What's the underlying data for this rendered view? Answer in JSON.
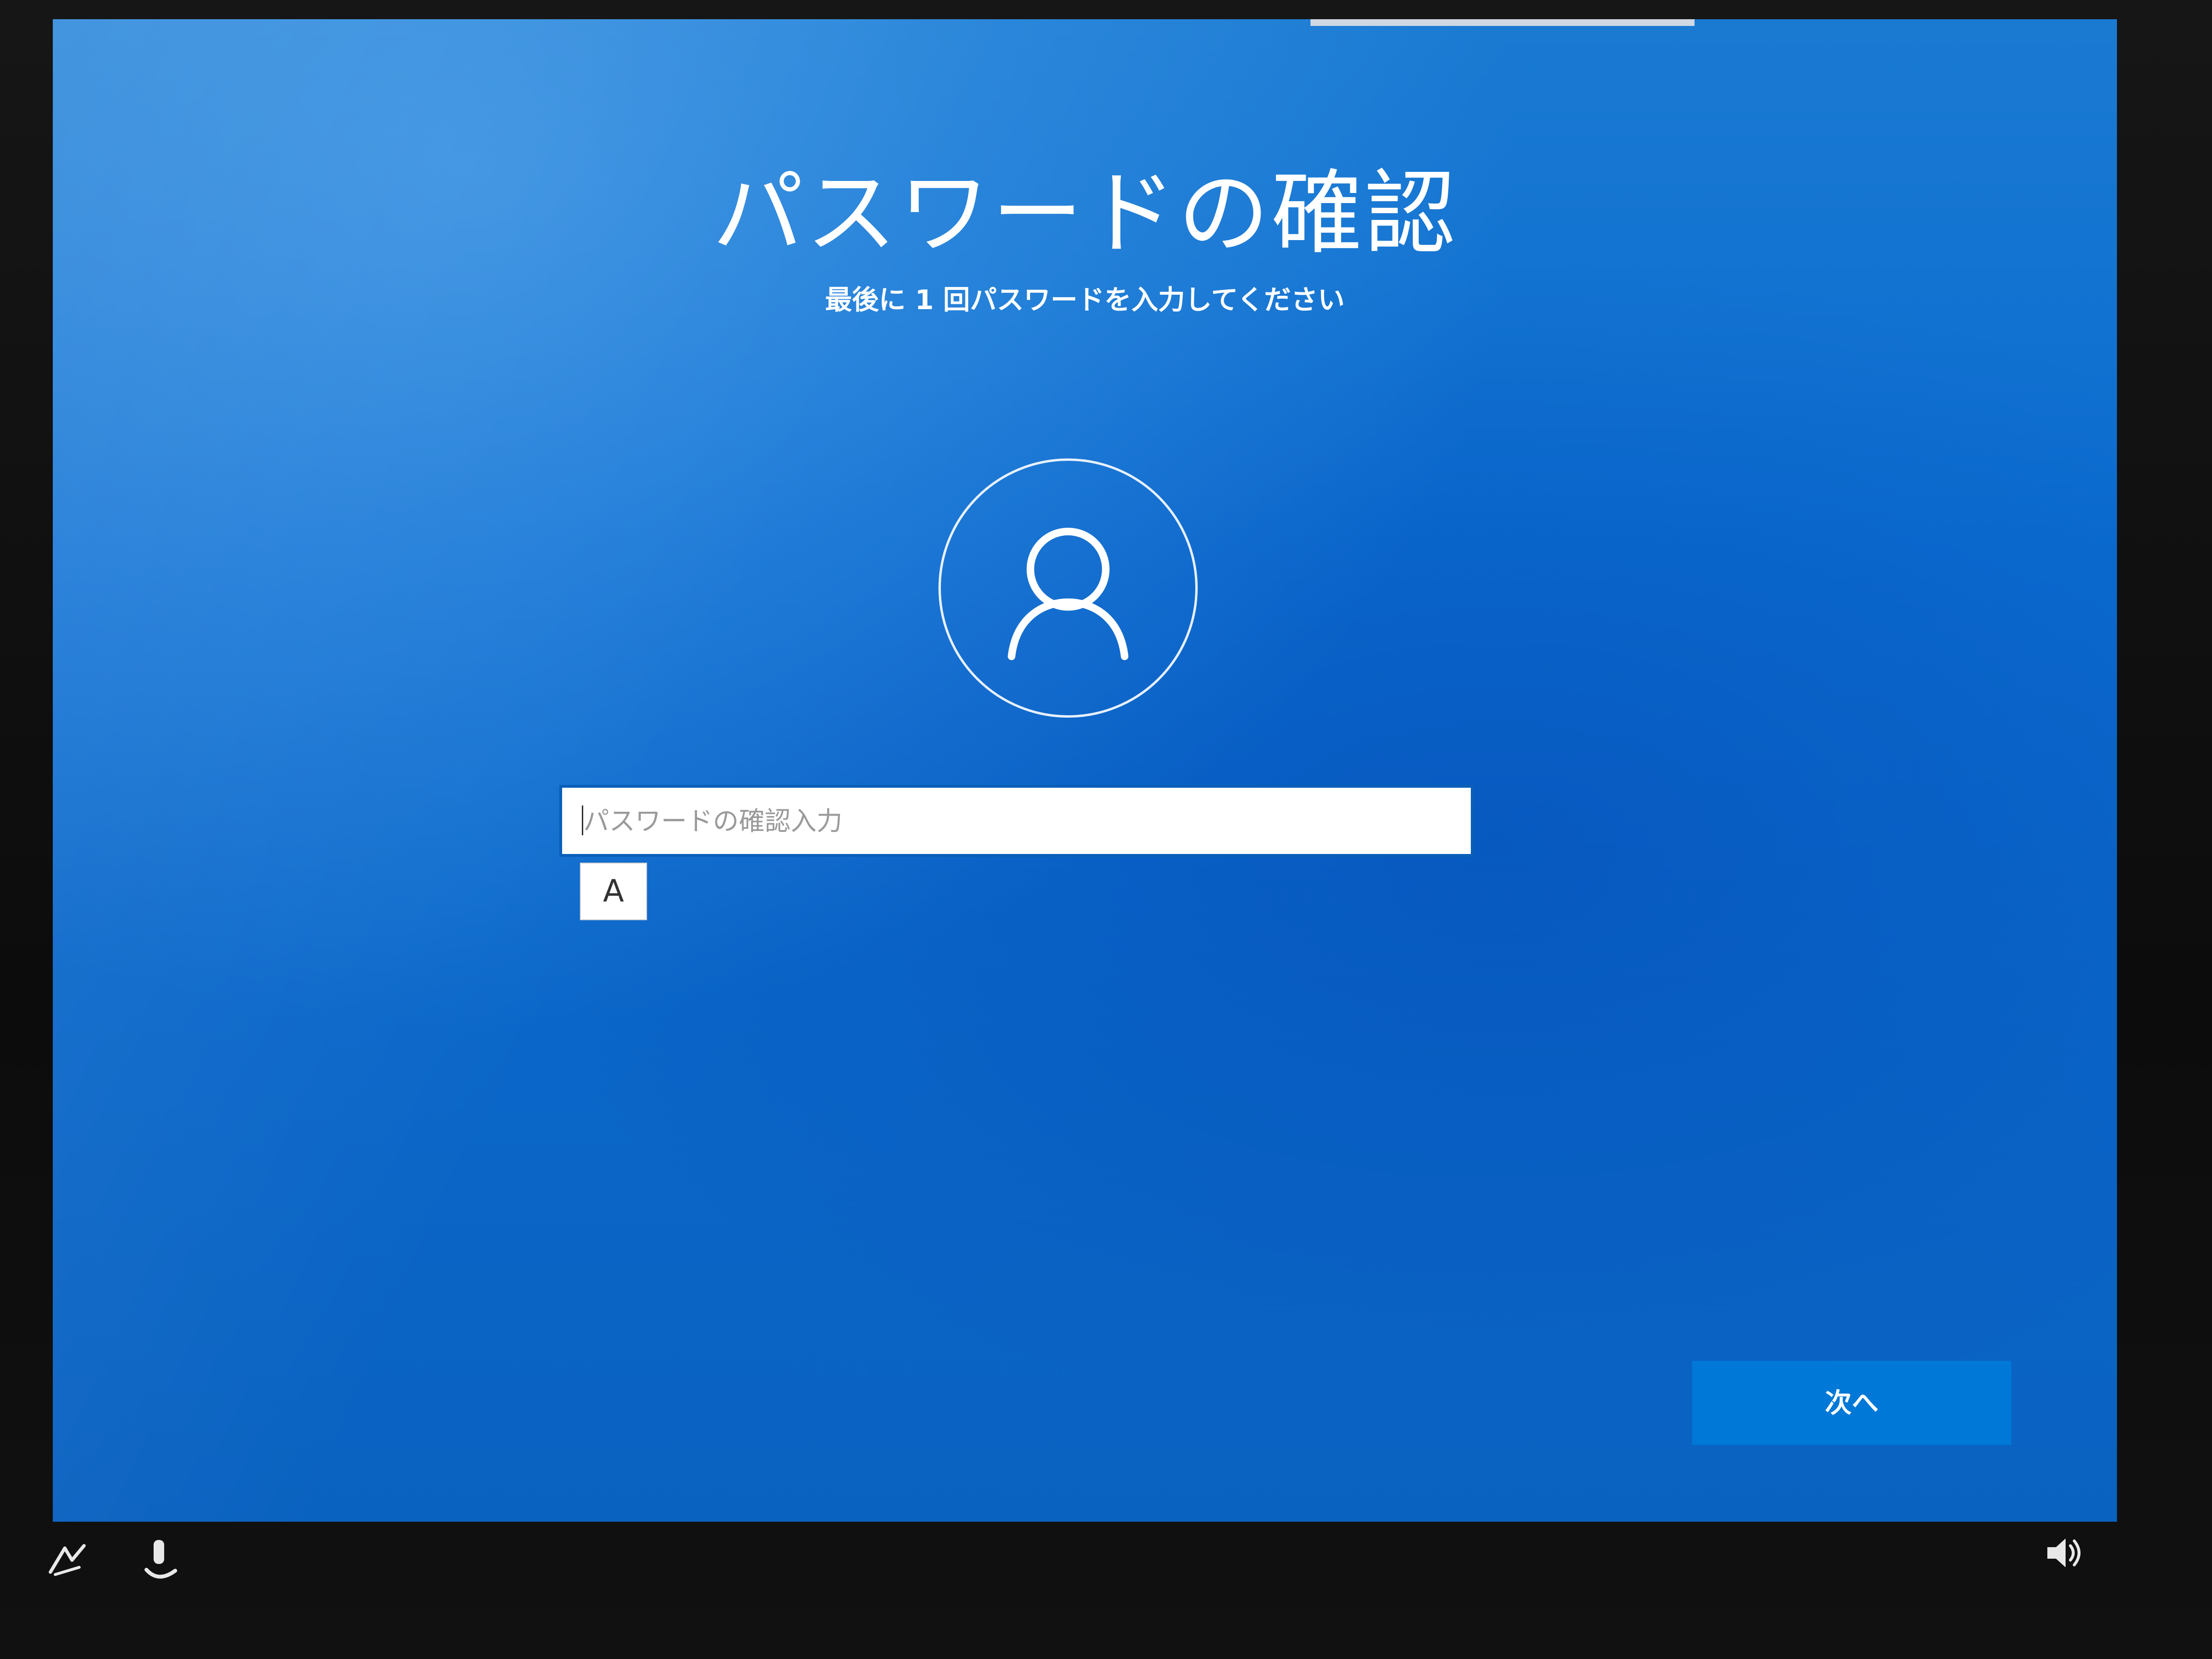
{
  "setup": {
    "title": "パスワードの確認",
    "subtitle": "最後に 1 回パスワードを入力してください"
  },
  "password_field": {
    "placeholder": "パスワードの確認入力",
    "value": ""
  },
  "ime": {
    "mode": "A"
  },
  "buttons": {
    "next_label": "次へ"
  },
  "icons": {
    "avatar": "user-icon",
    "ease_of_access": "ease-of-access-icon",
    "accessibility": "accessibility-icon",
    "volume": "volume-icon"
  },
  "colors": {
    "background": "#0a66c8",
    "button": "#0078d7",
    "text": "#ffffff"
  }
}
